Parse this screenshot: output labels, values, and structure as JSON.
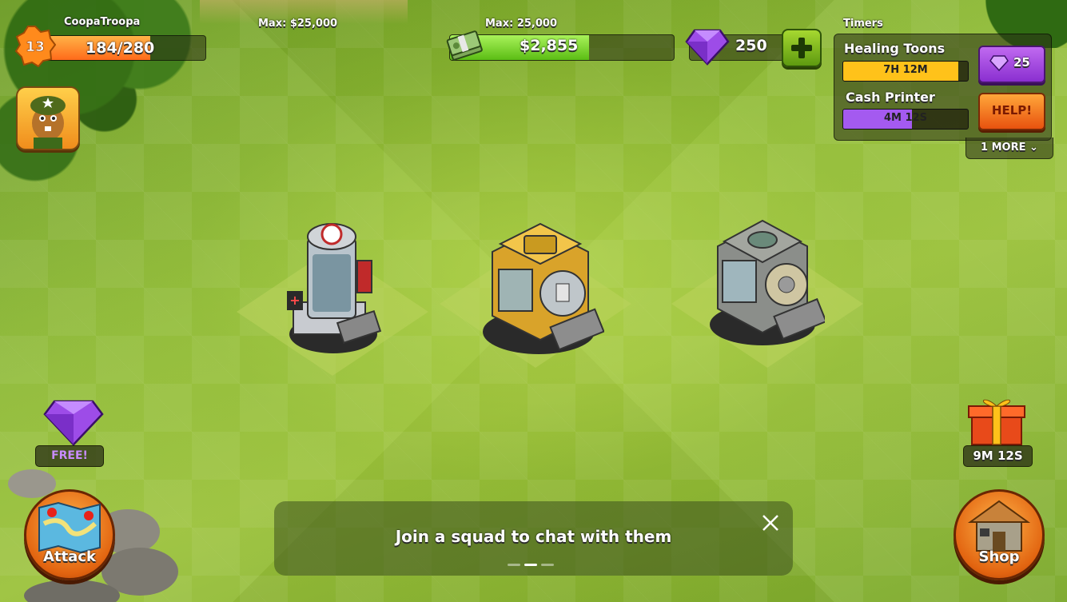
{
  "player": {
    "name": "CoopaTroopa",
    "level": "13",
    "xp_text": "184/280",
    "xp_progress": 0.657
  },
  "gold": {
    "max_label": "Max: $25,000"
  },
  "cash": {
    "max_label": "Max: 25,000",
    "amount": "$2,855",
    "progress": 0.62
  },
  "gems": {
    "amount": "250"
  },
  "timers": {
    "title": "Timers",
    "items": [
      {
        "label": "Healing Toons",
        "time": "7H 12M",
        "progress": 0.92,
        "color": "#ffc21a"
      },
      {
        "label": "Cash Printer",
        "time": "4M 12S",
        "progress": 0.55,
        "color": "#a45af0"
      }
    ],
    "gem_cost": "25",
    "help_label": "HELP!",
    "more_label": "1 MORE"
  },
  "free_gem": {
    "label": "FREE!"
  },
  "gift": {
    "timer": "9M 12S"
  },
  "buttons": {
    "attack": "Attack",
    "shop": "Shop"
  },
  "tip": {
    "text": "Join a squad to chat with them",
    "page_count": 3,
    "active_page": 1
  },
  "colors": {
    "grass": "#8fbb36",
    "cash_green": "#5bbd14",
    "gem_purple": "#8a2fd0",
    "orange": "#e8520f"
  }
}
